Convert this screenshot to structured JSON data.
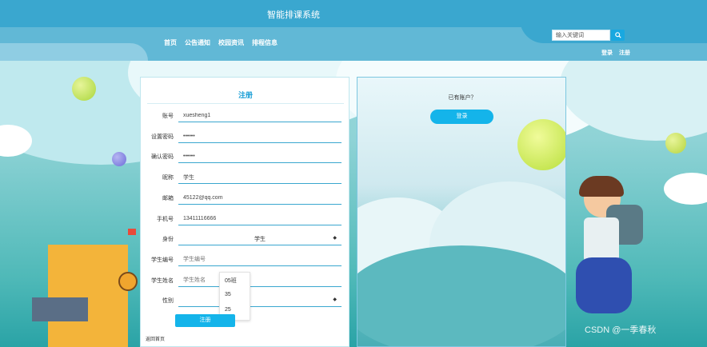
{
  "header": {
    "title": "智能排课系统",
    "nav": [
      "首页",
      "公告通知",
      "校园资讯",
      "排程信息"
    ],
    "search_placeholder": "输入关键词",
    "auth": [
      "登录",
      "注册"
    ]
  },
  "register": {
    "title": "注册",
    "fields": [
      {
        "label": "账号",
        "value": "xuesheng1"
      },
      {
        "label": "设置密码",
        "value": "••••••"
      },
      {
        "label": "确认密码",
        "value": "••••••"
      },
      {
        "label": "昵称",
        "value": "学生"
      },
      {
        "label": "邮箱",
        "value": "45122@qq.com"
      },
      {
        "label": "手机号",
        "value": "13411116666"
      },
      {
        "label": "身份",
        "value": "学生"
      },
      {
        "label": "学生编号",
        "value": "学生编号"
      },
      {
        "label": "学生姓名",
        "value": "学生姓名"
      },
      {
        "label": "性别",
        "value": ""
      }
    ],
    "dropdown_options": [
      "05班",
      "35",
      "25"
    ],
    "submit_label": "注册",
    "back_label": "返回首页"
  },
  "login_panel": {
    "prompt": "已有账户？",
    "login_label": "登录"
  },
  "watermark": "CSDN @一季春秋",
  "colors": {
    "header": "#3aa7cf",
    "accent": "#14b4ea",
    "title_blue": "#1c9fd6"
  }
}
